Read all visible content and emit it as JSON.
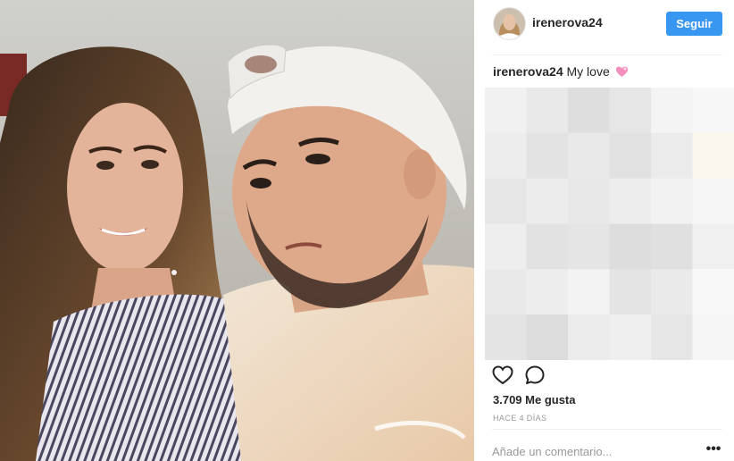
{
  "post": {
    "username": "irenerova24",
    "follow_label": "Seguir",
    "caption": {
      "author": "irenerova24",
      "text": "My love",
      "emoji": "pink-sparkling-heart"
    },
    "likes_text": "3.709 Me gusta",
    "time_text": "HACE 4 DÍAS",
    "comment_placeholder": "Añade un comentario...",
    "more_label": "•••"
  },
  "icons": {
    "like": "heart-outline-icon",
    "comment": "speech-bubble-icon",
    "options": "ellipsis-icon"
  },
  "colors": {
    "follow_button": "#3897f0",
    "text": "#262626",
    "muted": "#999999",
    "divider": "#efefef"
  }
}
